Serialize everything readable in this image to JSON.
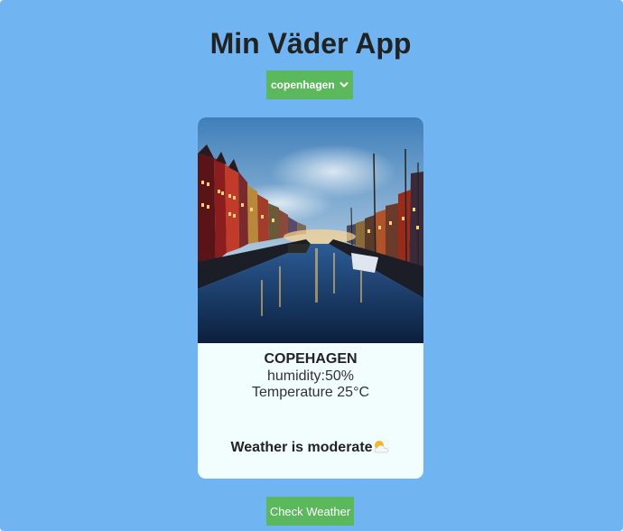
{
  "app": {
    "title": "Min Väder App"
  },
  "city_select": {
    "selected": "copenhagen",
    "options": [
      "copenhagen"
    ]
  },
  "card": {
    "city_name": "COPEHAGEN",
    "humidity_label": "humidity:",
    "humidity_value": "50%",
    "temperature_label": "Temperature",
    "temperature_value": "25°C",
    "status_text": "Weather is moderate",
    "status_icon": "sun-behind-cloud-icon"
  },
  "check_button": {
    "label": "Check Weather"
  },
  "colors": {
    "page_background": "#70b5f1",
    "accent_green": "#5cb85c",
    "card_background": "#f2fdfe"
  }
}
